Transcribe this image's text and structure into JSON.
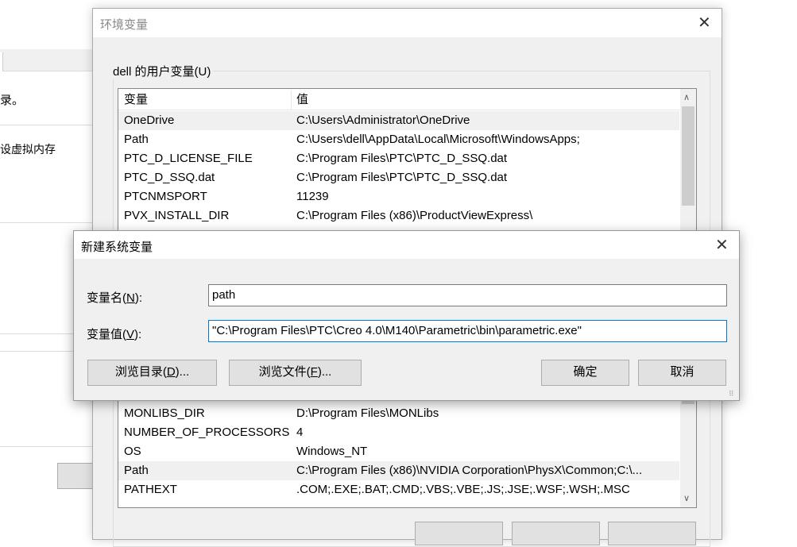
{
  "background_window": {
    "text1": "录。",
    "text2": "设虚拟内存"
  },
  "env_dialog": {
    "title": "环境变量",
    "user_group_label": "dell 的用户变量(U)",
    "columns": [
      "变量",
      "值"
    ],
    "user_vars": [
      {
        "name": "OneDrive",
        "value": "C:\\Users\\Administrator\\OneDrive"
      },
      {
        "name": "Path",
        "value": "C:\\Users\\dell\\AppData\\Local\\Microsoft\\WindowsApps;"
      },
      {
        "name": "PTC_D_LICENSE_FILE",
        "value": "C:\\Program Files\\PTC\\PTC_D_SSQ.dat"
      },
      {
        "name": "PTC_D_SSQ.dat",
        "value": "C:\\Program Files\\PTC\\PTC_D_SSQ.dat"
      },
      {
        "name": "PTCNMSPORT",
        "value": "11239"
      },
      {
        "name": "PVX_INSTALL_DIR",
        "value": "C:\\Program Files (x86)\\ProductViewExpress\\"
      }
    ],
    "system_vars": [
      {
        "name": "MONLIBS_DIR",
        "value": "D:\\Program Files\\MONLibs"
      },
      {
        "name": "NUMBER_OF_PROCESSORS",
        "value": "4"
      },
      {
        "name": "OS",
        "value": "Windows_NT"
      },
      {
        "name": "Path",
        "value": "C:\\Program Files (x86)\\NVIDIA Corporation\\PhysX\\Common;C:\\..."
      },
      {
        "name": "PATHEXT",
        "value": ".COM;.EXE;.BAT;.CMD;.VBS;.VBE;.JS;.JSE;.WSF;.WSH;.MSC"
      }
    ]
  },
  "new_var_dialog": {
    "title": "新建系统变量",
    "name_label": "变量名(",
    "name_key": "N",
    "name_label_end": "):",
    "name_value": "path",
    "value_label": "变量值(",
    "value_key": "V",
    "value_label_end": "):",
    "value_value": "\"C:\\Program Files\\PTC\\Creo 4.0\\M140\\Parametric\\bin\\parametric.exe\"",
    "browse_dir": "浏览目录(",
    "browse_dir_key": "D",
    "browse_dir_end": ")...",
    "browse_file": "浏览文件(",
    "browse_file_key": "F",
    "browse_file_end": ")...",
    "ok": "确定",
    "cancel": "取消"
  }
}
